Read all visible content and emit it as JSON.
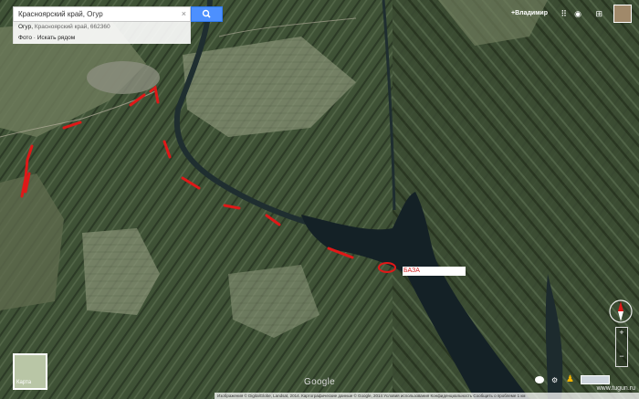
{
  "search": {
    "value": "Красноярский край, Огур"
  },
  "suggestions": [
    {
      "main": "Огур,",
      "secondary": "Красноярский край, 662360"
    },
    {
      "main": "Фото · Искать рядом",
      "secondary": ""
    }
  ],
  "topbar": {
    "user": "+Владимир"
  },
  "map_label": {
    "text": "БАЗА"
  },
  "minimap": {
    "label": "Карта"
  },
  "logo": {
    "text": "Google"
  },
  "attribution": {
    "text": "Изображения © DigitalGlobe, Landsat, 2014. Картографические данные © Google, 2014    Условия использования    Конфиденциальность    Сообщить о проблеме    1 км"
  },
  "watermark": {
    "text": "www.tugun.ru"
  },
  "colors": {
    "route": "#e01818",
    "accent": "#4d90fe",
    "water": "#142126"
  }
}
